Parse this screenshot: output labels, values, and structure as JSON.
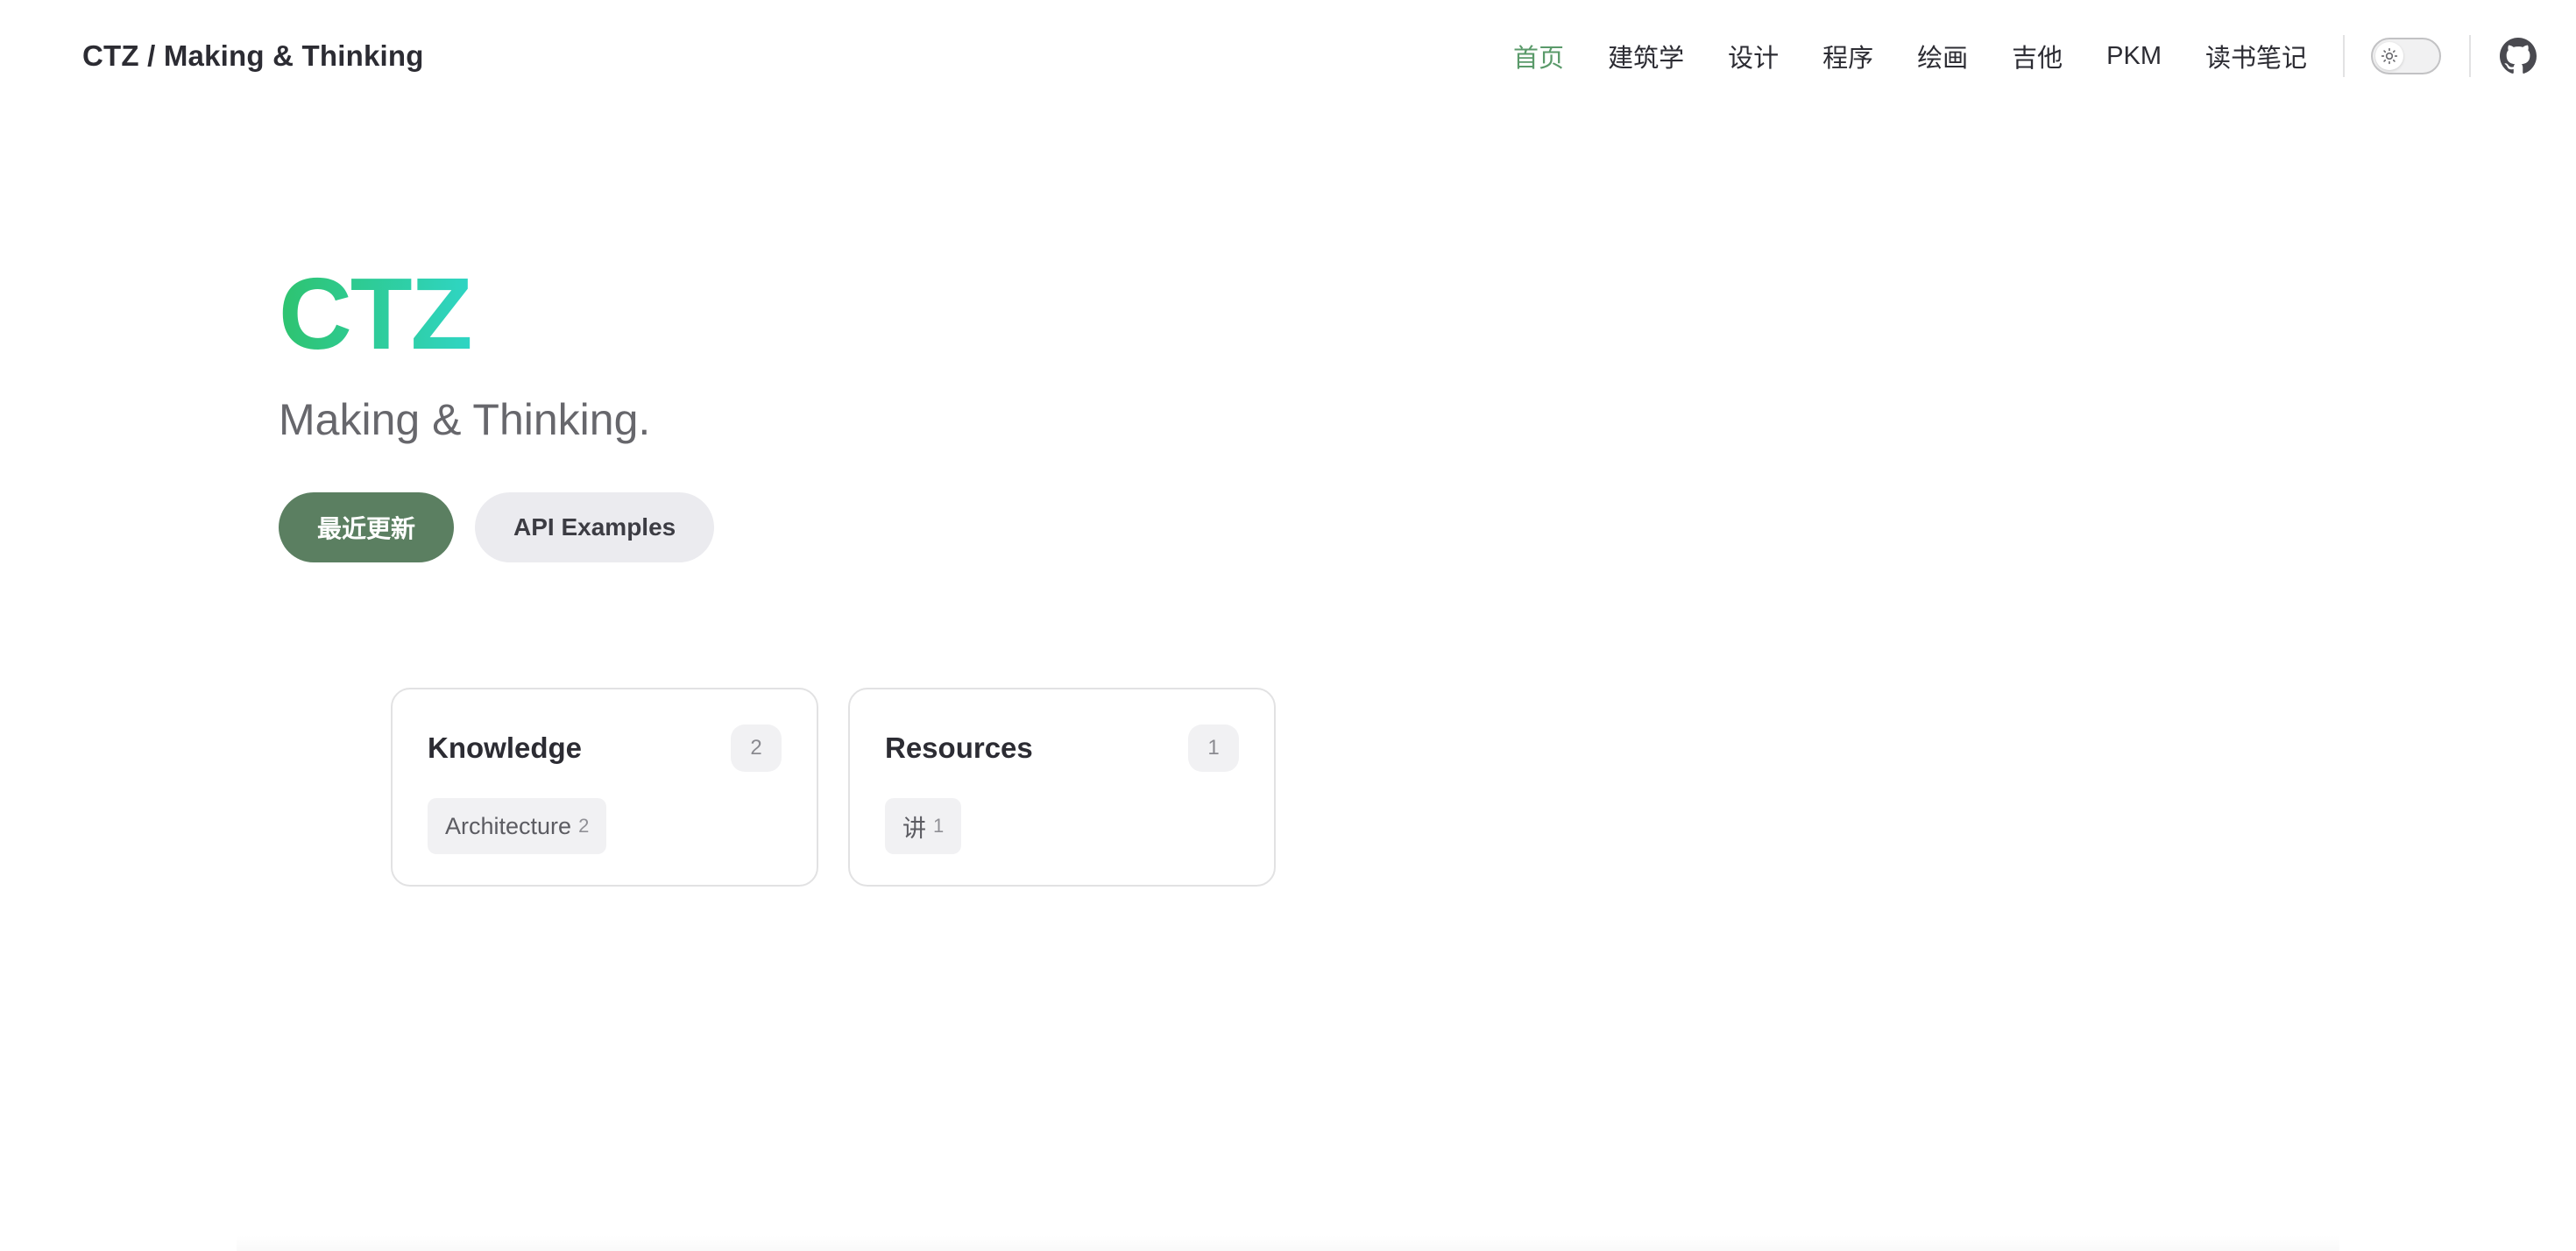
{
  "nav": {
    "brand": "CTZ / Making & Thinking",
    "links": [
      {
        "label": "首页",
        "active": true
      },
      {
        "label": "建筑学"
      },
      {
        "label": "设计"
      },
      {
        "label": "程序"
      },
      {
        "label": "绘画"
      },
      {
        "label": "吉他"
      },
      {
        "label": "PKM"
      },
      {
        "label": "读书笔记"
      }
    ],
    "theme_icon": "sun-icon",
    "github_icon": "github-icon"
  },
  "hero": {
    "name": "CTZ",
    "tagline": "Making & Thinking.",
    "actions": [
      {
        "label": "最近更新",
        "theme": "brand"
      },
      {
        "label": "API Examples",
        "theme": "alt"
      }
    ]
  },
  "cards": [
    {
      "title": "Knowledge",
      "count": "2",
      "tags": [
        {
          "label": "Architecture",
          "count": "2"
        }
      ]
    },
    {
      "title": "Resources",
      "count": "1",
      "tags": [
        {
          "label": "讲",
          "count": "1"
        }
      ]
    }
  ],
  "colors": {
    "brand": "#5b7f61",
    "active_link": "#5a9a6a",
    "hero_gradient_start": "#2ec36f",
    "hero_gradient_end": "#2fd5c4"
  }
}
